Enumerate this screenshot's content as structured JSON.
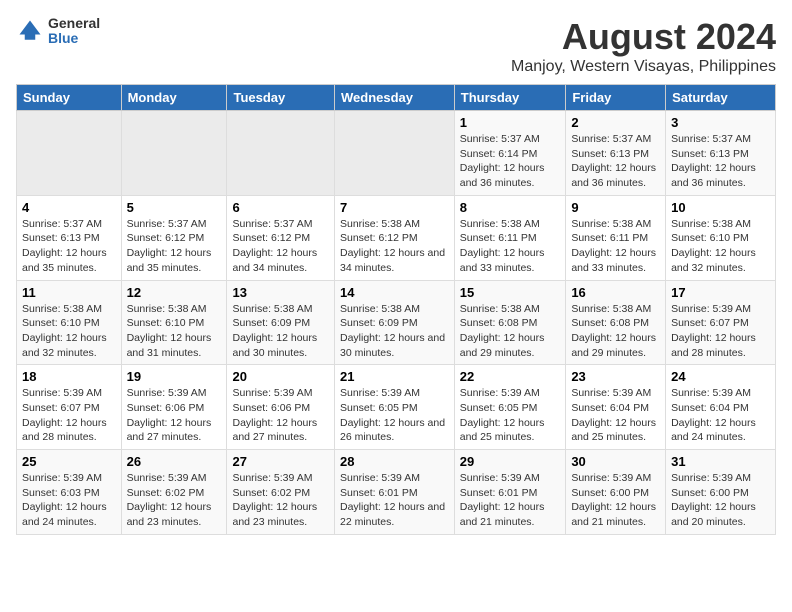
{
  "logo": {
    "general": "General",
    "blue": "Blue"
  },
  "title": "August 2024",
  "subtitle": "Manjoy, Western Visayas, Philippines",
  "days_of_week": [
    "Sunday",
    "Monday",
    "Tuesday",
    "Wednesday",
    "Thursday",
    "Friday",
    "Saturday"
  ],
  "weeks": [
    [
      {
        "day": "",
        "info": ""
      },
      {
        "day": "",
        "info": ""
      },
      {
        "day": "",
        "info": ""
      },
      {
        "day": "",
        "info": ""
      },
      {
        "day": "1",
        "info": "Sunrise: 5:37 AM\nSunset: 6:14 PM\nDaylight: 12 hours and 36 minutes."
      },
      {
        "day": "2",
        "info": "Sunrise: 5:37 AM\nSunset: 6:13 PM\nDaylight: 12 hours and 36 minutes."
      },
      {
        "day": "3",
        "info": "Sunrise: 5:37 AM\nSunset: 6:13 PM\nDaylight: 12 hours and 36 minutes."
      }
    ],
    [
      {
        "day": "4",
        "info": "Sunrise: 5:37 AM\nSunset: 6:13 PM\nDaylight: 12 hours and 35 minutes."
      },
      {
        "day": "5",
        "info": "Sunrise: 5:37 AM\nSunset: 6:12 PM\nDaylight: 12 hours and 35 minutes."
      },
      {
        "day": "6",
        "info": "Sunrise: 5:37 AM\nSunset: 6:12 PM\nDaylight: 12 hours and 34 minutes."
      },
      {
        "day": "7",
        "info": "Sunrise: 5:38 AM\nSunset: 6:12 PM\nDaylight: 12 hours and 34 minutes."
      },
      {
        "day": "8",
        "info": "Sunrise: 5:38 AM\nSunset: 6:11 PM\nDaylight: 12 hours and 33 minutes."
      },
      {
        "day": "9",
        "info": "Sunrise: 5:38 AM\nSunset: 6:11 PM\nDaylight: 12 hours and 33 minutes."
      },
      {
        "day": "10",
        "info": "Sunrise: 5:38 AM\nSunset: 6:10 PM\nDaylight: 12 hours and 32 minutes."
      }
    ],
    [
      {
        "day": "11",
        "info": "Sunrise: 5:38 AM\nSunset: 6:10 PM\nDaylight: 12 hours and 32 minutes."
      },
      {
        "day": "12",
        "info": "Sunrise: 5:38 AM\nSunset: 6:10 PM\nDaylight: 12 hours and 31 minutes."
      },
      {
        "day": "13",
        "info": "Sunrise: 5:38 AM\nSunset: 6:09 PM\nDaylight: 12 hours and 30 minutes."
      },
      {
        "day": "14",
        "info": "Sunrise: 5:38 AM\nSunset: 6:09 PM\nDaylight: 12 hours and 30 minutes."
      },
      {
        "day": "15",
        "info": "Sunrise: 5:38 AM\nSunset: 6:08 PM\nDaylight: 12 hours and 29 minutes."
      },
      {
        "day": "16",
        "info": "Sunrise: 5:38 AM\nSunset: 6:08 PM\nDaylight: 12 hours and 29 minutes."
      },
      {
        "day": "17",
        "info": "Sunrise: 5:39 AM\nSunset: 6:07 PM\nDaylight: 12 hours and 28 minutes."
      }
    ],
    [
      {
        "day": "18",
        "info": "Sunrise: 5:39 AM\nSunset: 6:07 PM\nDaylight: 12 hours and 28 minutes."
      },
      {
        "day": "19",
        "info": "Sunrise: 5:39 AM\nSunset: 6:06 PM\nDaylight: 12 hours and 27 minutes."
      },
      {
        "day": "20",
        "info": "Sunrise: 5:39 AM\nSunset: 6:06 PM\nDaylight: 12 hours and 27 minutes."
      },
      {
        "day": "21",
        "info": "Sunrise: 5:39 AM\nSunset: 6:05 PM\nDaylight: 12 hours and 26 minutes."
      },
      {
        "day": "22",
        "info": "Sunrise: 5:39 AM\nSunset: 6:05 PM\nDaylight: 12 hours and 25 minutes."
      },
      {
        "day": "23",
        "info": "Sunrise: 5:39 AM\nSunset: 6:04 PM\nDaylight: 12 hours and 25 minutes."
      },
      {
        "day": "24",
        "info": "Sunrise: 5:39 AM\nSunset: 6:04 PM\nDaylight: 12 hours and 24 minutes."
      }
    ],
    [
      {
        "day": "25",
        "info": "Sunrise: 5:39 AM\nSunset: 6:03 PM\nDaylight: 12 hours and 24 minutes."
      },
      {
        "day": "26",
        "info": "Sunrise: 5:39 AM\nSunset: 6:02 PM\nDaylight: 12 hours and 23 minutes."
      },
      {
        "day": "27",
        "info": "Sunrise: 5:39 AM\nSunset: 6:02 PM\nDaylight: 12 hours and 23 minutes."
      },
      {
        "day": "28",
        "info": "Sunrise: 5:39 AM\nSunset: 6:01 PM\nDaylight: 12 hours and 22 minutes."
      },
      {
        "day": "29",
        "info": "Sunrise: 5:39 AM\nSunset: 6:01 PM\nDaylight: 12 hours and 21 minutes."
      },
      {
        "day": "30",
        "info": "Sunrise: 5:39 AM\nSunset: 6:00 PM\nDaylight: 12 hours and 21 minutes."
      },
      {
        "day": "31",
        "info": "Sunrise: 5:39 AM\nSunset: 6:00 PM\nDaylight: 12 hours and 20 minutes."
      }
    ]
  ]
}
